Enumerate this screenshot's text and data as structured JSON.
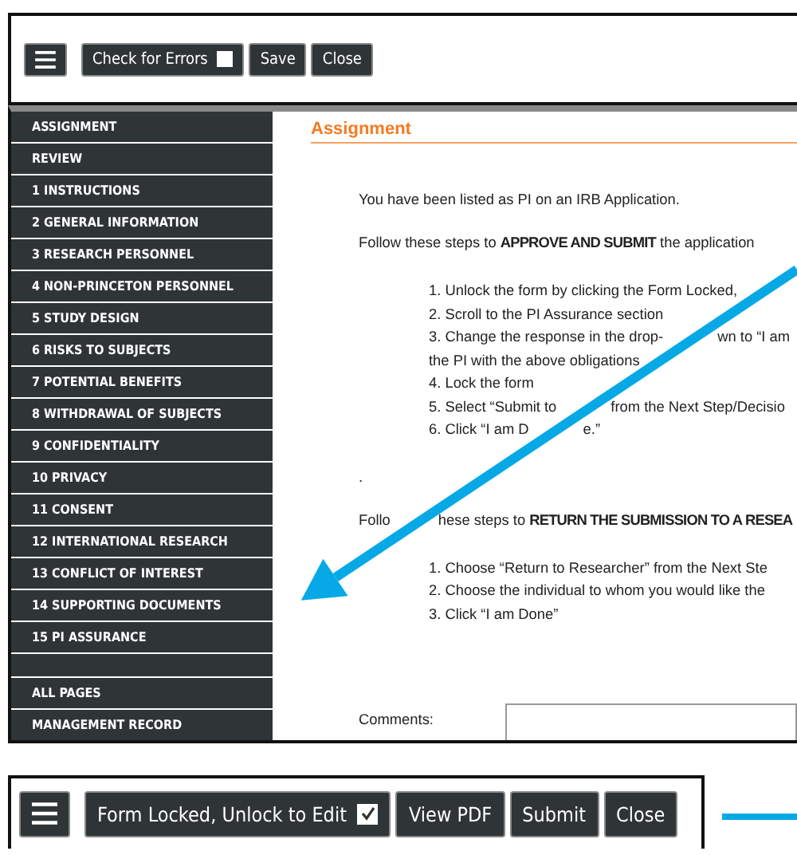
{
  "top_toolbar": {
    "buttons": [
      {
        "kind": "menu"
      },
      {
        "kind": "checkbox",
        "label": "Check for Errors",
        "checked": false
      },
      {
        "kind": "plain",
        "label": "Save"
      },
      {
        "kind": "plain",
        "label": "Close"
      }
    ]
  },
  "sidebar": {
    "items": [
      {
        "kind": "link",
        "label": "ASSIGNMENT"
      },
      {
        "kind": "link",
        "label": "REVIEW"
      },
      {
        "kind": "link",
        "label": "1 INSTRUCTIONS"
      },
      {
        "kind": "link",
        "label": "2 GENERAL INFORMATION"
      },
      {
        "kind": "link",
        "label": "3 RESEARCH PERSONNEL"
      },
      {
        "kind": "link",
        "label": "4 NON-PRINCETON PERSONNEL"
      },
      {
        "kind": "link",
        "label": "5 STUDY DESIGN"
      },
      {
        "kind": "link",
        "label": "6 RISKS TO SUBJECTS"
      },
      {
        "kind": "link",
        "label": "7 POTENTIAL BENEFITS"
      },
      {
        "kind": "link",
        "label": "8 WITHDRAWAL OF SUBJECTS"
      },
      {
        "kind": "link",
        "label": "9 CONFIDENTIALITY"
      },
      {
        "kind": "link",
        "label": "10 PRIVACY"
      },
      {
        "kind": "link",
        "label": "11 CONSENT"
      },
      {
        "kind": "link",
        "label": "12 INTERNATIONAL RESEARCH"
      },
      {
        "kind": "link",
        "label": "13 CONFLICT OF INTEREST"
      },
      {
        "kind": "link",
        "label": "14 SUPPORTING DOCUMENTS"
      },
      {
        "kind": "link",
        "label": "15 PI ASSURANCE"
      },
      {
        "kind": "blank"
      },
      {
        "kind": "link",
        "label": "ALL PAGES"
      },
      {
        "kind": "link",
        "label": "MANAGEMENT RECORD"
      }
    ]
  },
  "content": {
    "heading": "Assignment",
    "blocks": [
      {
        "kind": "para",
        "segments": [
          "You have been listed as PI on an IRB Application."
        ]
      },
      {
        "kind": "para",
        "segments": [
          "Follow these steps to **APPROVE AND SUBMIT** the application"
        ]
      },
      {
        "kind": "list",
        "items": [
          [
            "1. Unlock the form by clicking the Form Locked,"
          ],
          [
            "2. Scroll to the PI Assurance section"
          ],
          [
            "3.  Change the response in the drop-",
            "wn to “I am"
          ],
          [
            "the PI with the above obligations"
          ],
          [
            "4. Lock the form"
          ],
          [
            "5. Select “Submit to",
            "from the Next Step/Decisio"
          ],
          [
            "6. Click “I am D",
            "e.”"
          ]
        ]
      },
      {
        "kind": "para",
        "segments": [
          "."
        ]
      },
      {
        "kind": "para",
        "segments": [
          "Follo",
          "hese steps to **RETURN THE SUBMISSION TO A RESEA**"
        ]
      },
      {
        "kind": "list",
        "items": [
          [
            "1. Choose “Return to Researcher” from the Next Ste"
          ],
          [
            "2. Choose the individual to whom you would like the"
          ],
          [
            "3. Click “I am Done”"
          ]
        ]
      }
    ],
    "comments_label": "Comments:"
  },
  "bottom_toolbar": {
    "buttons": [
      {
        "kind": "menu"
      },
      {
        "kind": "checkbox",
        "label": "Form Locked, Unlock to Edit",
        "checked": true
      },
      {
        "kind": "plain",
        "label": "View PDF"
      },
      {
        "kind": "plain",
        "label": "Submit"
      },
      {
        "kind": "plain",
        "label": "Close"
      }
    ]
  }
}
